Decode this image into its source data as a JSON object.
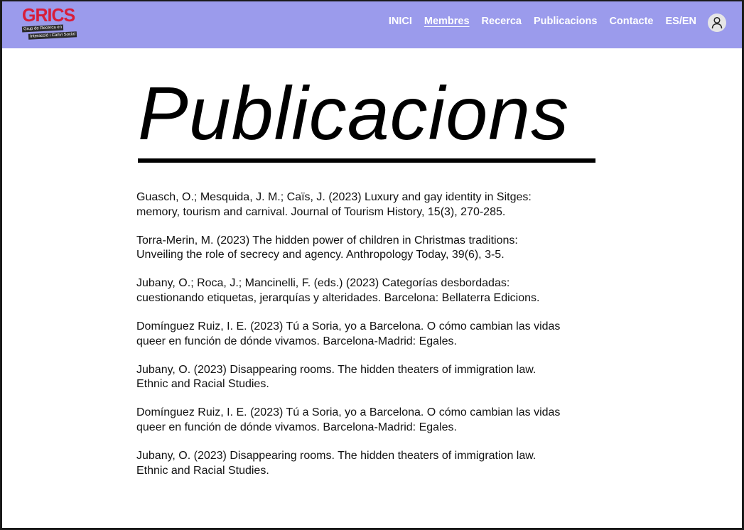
{
  "header": {
    "logo": {
      "wordmark": "GRICS",
      "tagline_line1": "Grup de Recerca en",
      "tagline_line2": "Interacció i Canvi Social"
    },
    "nav": [
      {
        "label": "INICI",
        "active": false
      },
      {
        "label": "Membres",
        "active": true
      },
      {
        "label": "Recerca",
        "active": false
      },
      {
        "label": "Publicacions",
        "active": false
      },
      {
        "label": "Contacte",
        "active": false
      },
      {
        "label": "ES/EN",
        "active": false
      }
    ],
    "user_icon": "user-avatar-icon"
  },
  "main": {
    "title": "Publicacions",
    "publications": [
      {
        "line1": "Guasch, O.; Mesquida, J. M.; Caïs, J. (2023) Luxury and gay identity in Sitges:",
        "line2": "memory, tourism and carnival. Journal of Tourism History, 15(3), 270-285."
      },
      {
        "line1": "Torra-Merin, M. (2023) The hidden power of children in Christmas traditions:",
        "line2": "Unveiling the role of secrecy and agency. Anthropology Today, 39(6), 3-5."
      },
      {
        "line1": "Jubany, O.; Roca, J.; Mancinelli, F. (eds.) (2023) Categorías desbordadas:",
        "line2": "cuestionando etiquetas, jerarquías y alteridades. Barcelona: Bellaterra Edicions."
      },
      {
        "line1": "Domínguez Ruiz, I. E. (2023) Tú a Soria, yo a Barcelona. O cómo cambian las vidas",
        "line2": "queer en función de dónde vivamos. Barcelona-Madrid: Egales."
      },
      {
        "line1": "Jubany, O. (2023) Disappearing rooms. The hidden theaters of immigration law.",
        "line2": "Ethnic and Racial Studies."
      },
      {
        "line1": "Domínguez Ruiz, I. E. (2023) Tú a Soria, yo a Barcelona. O cómo cambian las vidas",
        "line2": "queer en función de dónde vivamos. Barcelona-Madrid: Egales."
      },
      {
        "line1": "Jubany, O. (2023) Disappearing rooms. The hidden theaters of immigration law.",
        "line2": "Ethnic and Racial Studies."
      }
    ]
  },
  "colors": {
    "header_bg": "#9b9bec",
    "logo_red": "#d81e3a",
    "text": "#111111"
  }
}
